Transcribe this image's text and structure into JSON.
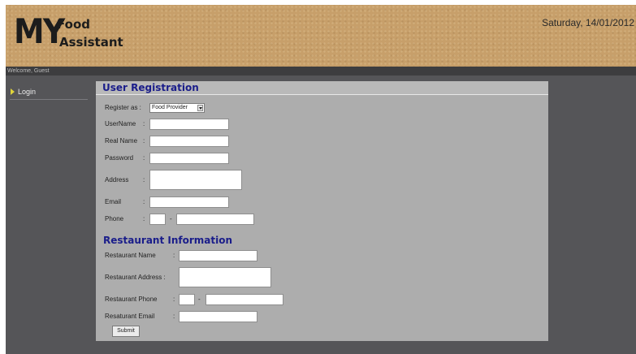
{
  "header": {
    "logo_my": "MY",
    "logo_food": "Food",
    "logo_assistant": "Assistant",
    "date": "Saturday, 14/01/2012"
  },
  "welcome": "Welcome, Guest",
  "nav": {
    "login": "Login"
  },
  "registration": {
    "title": "User Registration",
    "register_as_label": "Register as :",
    "register_as_value": "Food Provider",
    "username_label": "UserName",
    "realname_label": "Real Name",
    "password_label": "Password",
    "address_label": "Address",
    "email_label": "Email",
    "phone_label": "Phone",
    "colon": ":",
    "dash": "-"
  },
  "restaurant": {
    "title": "Restaurant Information",
    "name_label": "Restaurant Name",
    "address_label": "Restaurant Address :",
    "phone_label": "Restaurant Phone",
    "email_label": "Resaturant Email"
  },
  "submit_label": "Submit",
  "footer": "",
  "colors": {
    "header_bg": "#c79f6a",
    "title_blue": "#1a1d8a",
    "panel_bg": "#adadad",
    "page_bg": "#555558"
  }
}
